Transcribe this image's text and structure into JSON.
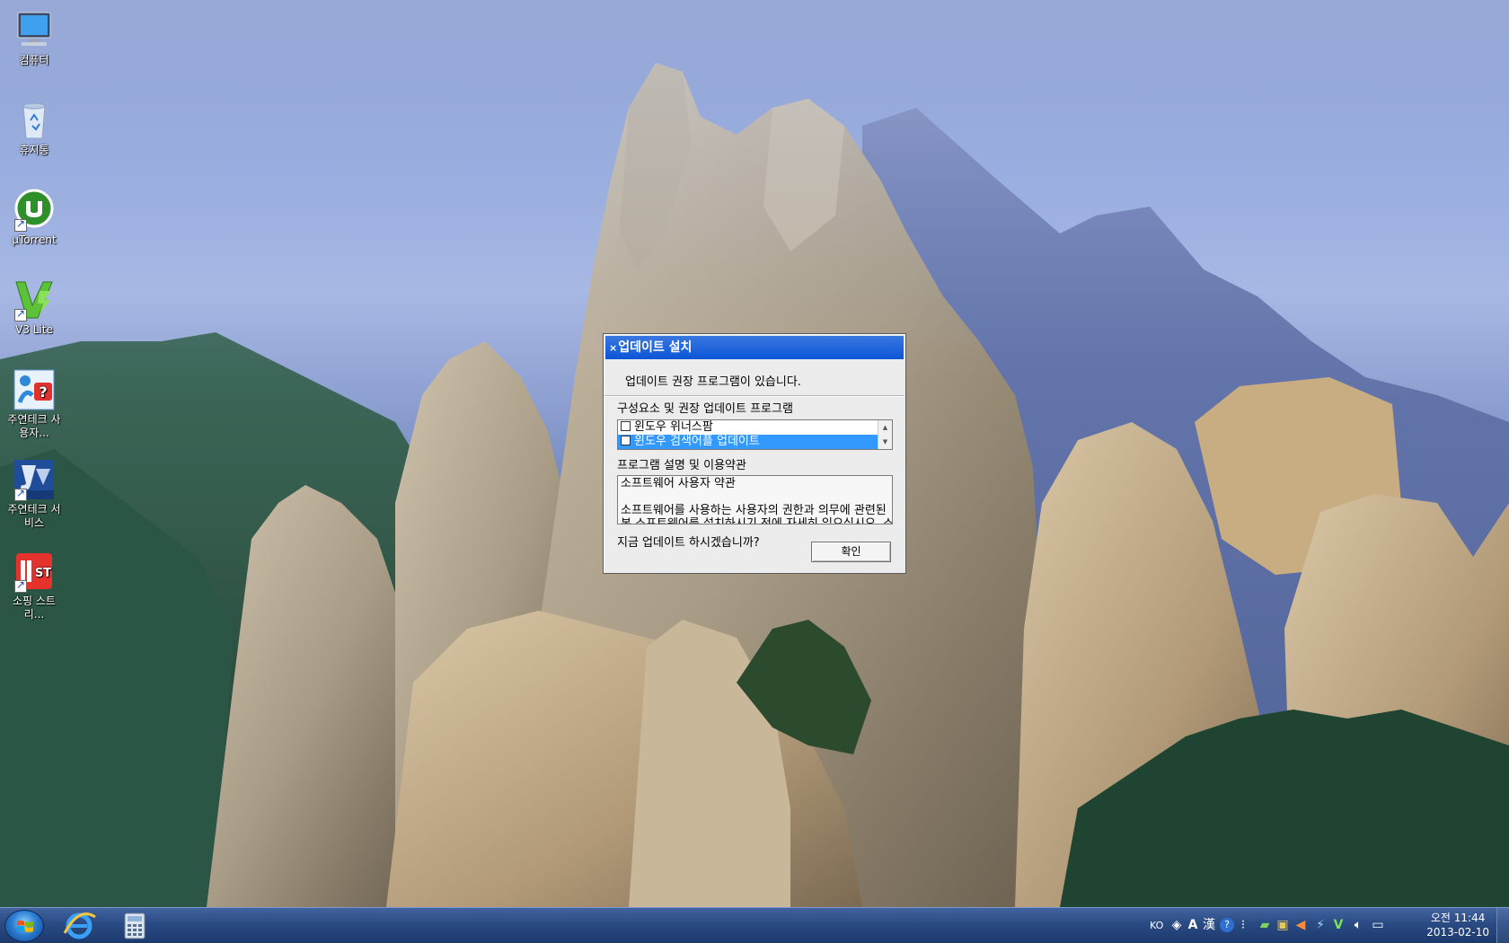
{
  "desktop": {
    "icons": [
      {
        "label": "컴퓨터",
        "icon": "computer-icon"
      },
      {
        "label": "휴지통",
        "icon": "recycle-bin-icon"
      },
      {
        "label": "µTorrent",
        "icon": "utorrent-icon"
      },
      {
        "label": "V3 Lite",
        "icon": "v3-lite-icon"
      },
      {
        "label": "주연테크 사용자...",
        "icon": "help-icon"
      },
      {
        "label": "주연테크 서비스",
        "icon": "service-icon"
      },
      {
        "label": "소핑 스트리...",
        "icon": "11st-shopping-icon"
      }
    ]
  },
  "dialog": {
    "title": "업데이트 설치",
    "intro": "업데이트 권장 프로그램이 있습니다.",
    "components_label": "구성요소 및 권장 업데이트 프로그램",
    "components": [
      {
        "label": "윈도우 위너스팜",
        "checked": false,
        "selected": false
      },
      {
        "label": "윈도우 검색어플 업데이트",
        "checked": false,
        "selected": true
      }
    ],
    "terms_label": "프로그램 설명 및 이용약관",
    "terms_lines": [
      "소프트웨어 사용자 약관",
      "",
      "소프트웨어를 사용하는 사용자의 권한과 의무에 관련된",
      "본 소프트웨어를 설치하시기 전에 자세히 읽으십시오. 소"
    ],
    "question": "지금 업데이트 하시겠습니까?",
    "ok_label": "확인"
  },
  "taskbar": {
    "apps": [
      {
        "icon": "internet-explorer-icon"
      },
      {
        "icon": "calculator-icon"
      }
    ],
    "tray": {
      "lang": "KO",
      "ime_a": "A",
      "ime_han": "漢",
      "help": "?",
      "time": "오전 11:44",
      "date": "2013-02-10"
    }
  },
  "colors": {
    "title_bar": "#0b55d6",
    "selection": "#3399ff",
    "taskbar": "#2a4a83"
  }
}
